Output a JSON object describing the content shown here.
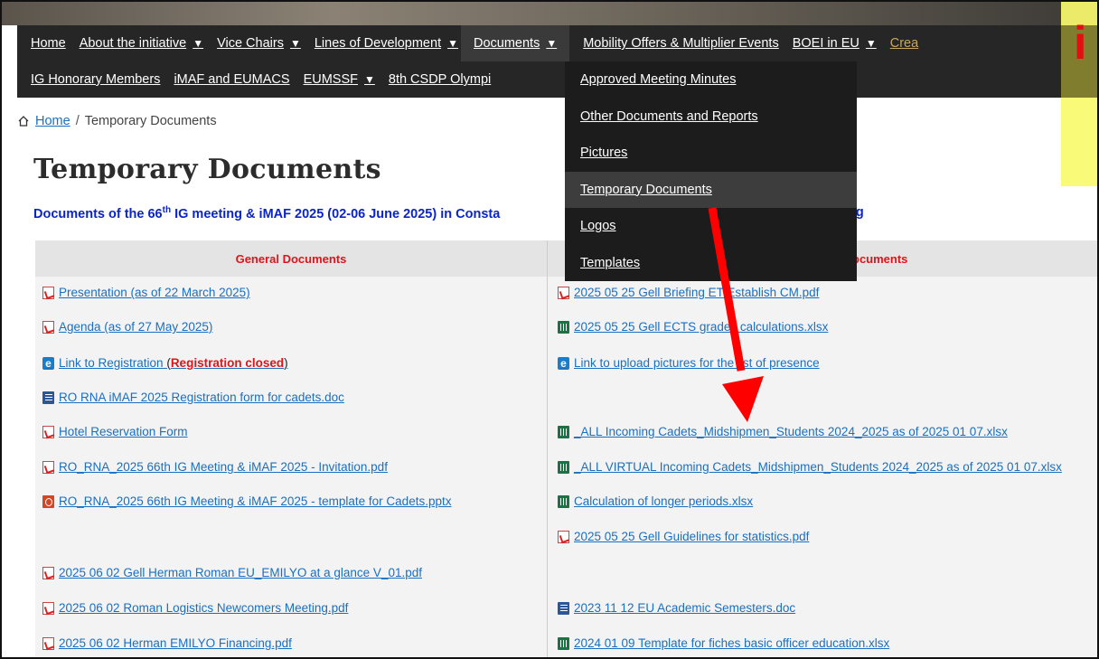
{
  "nav": {
    "row1": [
      {
        "label": "Home",
        "caret": false
      },
      {
        "label": "About the initiative",
        "caret": true
      },
      {
        "label": "Vice Chairs",
        "caret": true
      },
      {
        "label": "Lines of Development",
        "caret": true
      },
      {
        "label": "Documents",
        "caret": true
      },
      {
        "label": "Mobility Offers & Multiplier Events",
        "caret": false
      },
      {
        "label": "BOEI in EU",
        "caret": true
      },
      {
        "label": "Crea",
        "caret": false
      }
    ],
    "row2": [
      {
        "label": "IG Honorary Members",
        "caret": false
      },
      {
        "label": "iMAF and EUMACS",
        "caret": false
      },
      {
        "label": "EUMSSF",
        "caret": true
      },
      {
        "label": "8th CSDP Olympi",
        "caret": false
      }
    ],
    "caret_glyph": "▼"
  },
  "documents_menu": {
    "items": [
      {
        "label": "Approved Meeting Minutes"
      },
      {
        "label": "Other Documents and Reports"
      },
      {
        "label": "Pictures"
      },
      {
        "label": "Temporary Documents"
      },
      {
        "label": "Logos"
      },
      {
        "label": "Templates"
      }
    ],
    "highlighted": "Temporary Documents"
  },
  "breadcrumb": {
    "home": "Home",
    "separator": "/",
    "current": "Temporary Documents",
    "home_icon": "house-outline-icon"
  },
  "page": {
    "title": "Temporary Documents",
    "subtitle_pre": "Documents of the 66",
    "subtitle_sup": "th",
    "subtitle_left": " IG meeting & iMAF 2025 (02-06 June 2025) in Consta",
    "subtitle_right": "eeting"
  },
  "table": {
    "headers": {
      "left": "General Documents",
      "right": "ocuments"
    },
    "left": [
      {
        "icon": "pdf",
        "text": "Presentation (as of 22 March 2025)"
      },
      {
        "icon": "pdf",
        "text": "Agenda (as of 27 May 2025)"
      },
      {
        "icon": "ie",
        "text": "Link to Registration",
        "suffix_pre": " (",
        "suffix_red": "Registration closed",
        "suffix_post": ")"
      },
      {
        "icon": "doc",
        "text": "RO RNA iMAF 2025 Registration form for cadets.doc "
      },
      {
        "icon": "pdf",
        "text": "Hotel Reservation Form"
      },
      {
        "icon": "pdf",
        "text": "RO_RNA_2025 66th IG Meeting & iMAF 2025 - Invitation.pdf"
      },
      {
        "icon": "ppt",
        "text": "RO_RNA_2025 66th IG Meeting & iMAF 2025 - template for Cadets.pptx"
      },
      {
        "icon": "",
        "text": ""
      },
      {
        "icon": "pdf",
        "text": "2025 06 02 Gell Herman Roman EU_EMILYO at a glance V_01.pdf"
      },
      {
        "icon": "pdf",
        "text": "2025 06 02 Roman Logistics Newcomers Meeting.pdf"
      },
      {
        "icon": "pdf",
        "text": "2025 06 02 Herman EMILYO Financing.pdf"
      }
    ],
    "right": [
      {
        "icon": "pdf",
        "text": "2025 05 25 Gell Briefing ET Establish CM.pdf"
      },
      {
        "icon": "xls",
        "text": "2025 05 25 Gell ECTS grades calculations.xlsx"
      },
      {
        "icon": "ie",
        "text": "Link to upload pictures for the list of presence"
      },
      {
        "icon": "",
        "text": ""
      },
      {
        "icon": "xls",
        "text": "_ALL Incoming Cadets_Midshipmen_Students 2024_2025 as of 2025 01 07.xlsx"
      },
      {
        "icon": "xls",
        "text": "_ALL VIRTUAL Incoming Cadets_Midshipmen_Students 2024_2025 as of 2025 01 07.xlsx"
      },
      {
        "icon": "xls",
        "text": "Calculation of longer periods.xlsx"
      },
      {
        "icon": "pdf",
        "text": "2025 05 25 Gell Guidelines for statistics.pdf"
      },
      {
        "icon": "",
        "text": ""
      },
      {
        "icon": "doc",
        "text": "2023 11 12 EU Academic Semesters.doc"
      },
      {
        "icon": "xls",
        "text": "2024 01 09 Template for fiches basic officer education.xlsx"
      }
    ]
  },
  "overlay": {
    "corner_letter": "i",
    "arrow_color": "#ff0000",
    "highlight_color": "#fafa6e"
  }
}
